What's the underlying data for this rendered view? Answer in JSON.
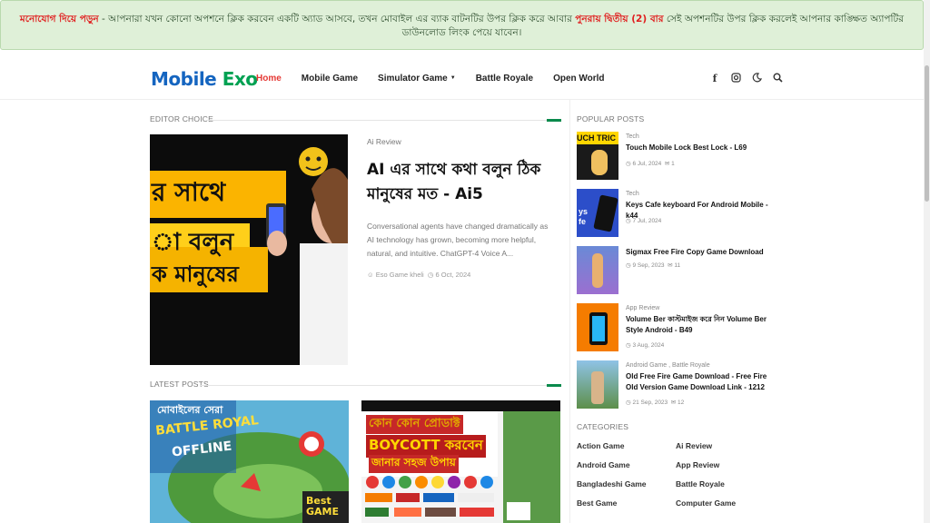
{
  "notice": {
    "highlight": "মনোযোগ দিয়ে পড়ুন",
    "text1": " - আপনারা যখন কোনো অপশনে ক্লিক করবেন একটি অ্যাড আসবে, তখন মোবাইল এর ব্যাক বাটনটির উপর ক্লিক করে আবার ",
    "highlight2": "পুনরায় দ্বিতীয় (2) বার",
    "text2": " সেই অপশনটির উপর ক্লিক করলেই আপনার কাঙ্ক্ষিত অ্যাপটির ডাউনলোড লিংক পেয়ে যাবেন।"
  },
  "header": {
    "logo_part1": "Mobile",
    "logo_part2": "Exo",
    "nav": [
      "Home",
      "Mobile Game",
      "Simulator Game",
      "Battle Royale",
      "Open World"
    ],
    "icons": [
      "facebook-icon",
      "instagram-icon",
      "dark-mode-icon",
      "search-icon"
    ]
  },
  "editor_choice": {
    "heading": "EDITOR CHOICE",
    "image_text": [
      "র সাথে",
      "া বলুন",
      "ক মানুষের"
    ],
    "tag": "Ai Review",
    "title": "AI এর সাথে কথা বলুন ঠিক মানুষের মত - Ai5",
    "description": "Conversational agents have changed dramatically as AI technology has grown, becoming more helpful, natural, and intuitive. ChatGPT-4 Voice A...",
    "author": "Eso Game kheli",
    "date": "6 Oct, 2024"
  },
  "latest": {
    "heading": "LATEST POSTS",
    "post1_text": [
      "মোবাইলের সেরা",
      "BATTLE ROYAL",
      "OFFLINE",
      "Best GAME"
    ],
    "post2_text": [
      "কোন কোন প্রোডাক্ট",
      "BOYCOTT করবেন",
      "জানার সহজ উপায়"
    ]
  },
  "sidebar": {
    "popular_heading": "POPULAR POSTS",
    "posts": [
      {
        "cat": "Tech",
        "title": "Touch Mobile Lock Best Lock - L69",
        "date": "6 Jul, 2024",
        "count": "1",
        "thumb_text": "UCH TRIC"
      },
      {
        "cat": "Tech",
        "title": "Keys Cafe keyboard For Android Mobile - k44",
        "date": "7 Jul, 2024",
        "count": "",
        "thumb_text": "ys fe"
      },
      {
        "cat": "",
        "title": "Sigmax Free Fire Copy Game Download",
        "date": "9 Sep, 2023",
        "count": "11",
        "thumb_text": ""
      },
      {
        "cat": "App Review",
        "title": "Volume Ber কাস্টমাইজ করে নিন Volume Ber Style Android - B49",
        "date": "3 Aug, 2024",
        "count": "",
        "thumb_text": ""
      },
      {
        "cat": "Android Game , Battle Royale",
        "title": "Old Free Fire Game Download - Free Fire Old Version Game Download Link - 1212",
        "date": "21 Sep, 2023",
        "count": "12",
        "thumb_text": ""
      }
    ],
    "categories_heading": "CATEGORIES",
    "categories": [
      "Action Game",
      "Ai Review",
      "Android Game",
      "App Review",
      "Bangladeshi Game",
      "Battle Royale",
      "Best Game",
      "Computer Game"
    ]
  }
}
